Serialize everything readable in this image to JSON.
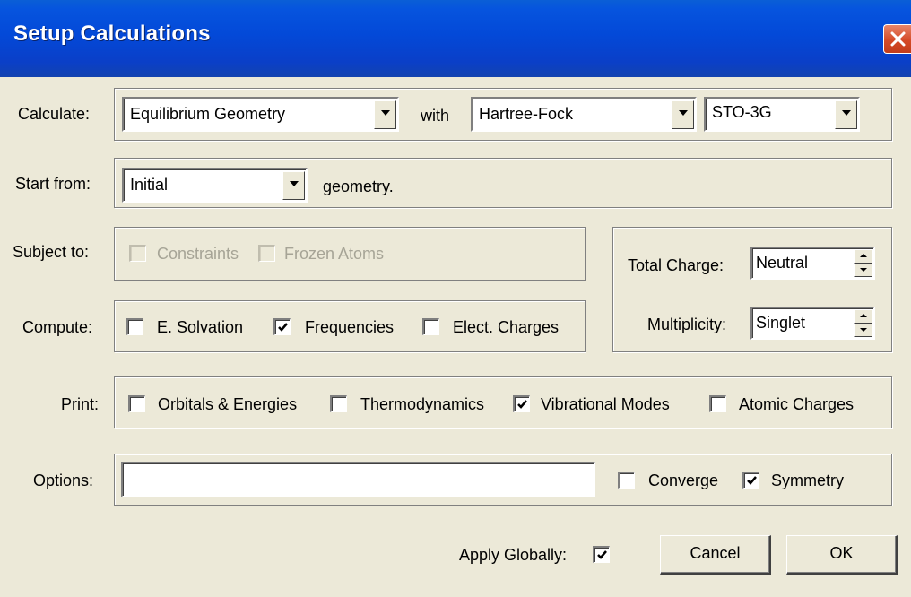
{
  "window": {
    "title": "Setup Calculations"
  },
  "calculate": {
    "label": "Calculate:",
    "task": "Equilibrium Geometry",
    "with_label": "with",
    "method": "Hartree-Fock",
    "basis": "STO-3G"
  },
  "start_from": {
    "label": "Start from:",
    "value": "Initial",
    "suffix": "geometry."
  },
  "subject_to": {
    "label": "Subject to:",
    "constraints": {
      "label": "Constraints",
      "checked": false,
      "enabled": false
    },
    "frozen_atoms": {
      "label": "Frozen Atoms",
      "checked": false,
      "enabled": false
    }
  },
  "compute": {
    "label": "Compute:",
    "e_solvation": {
      "label": "E. Solvation",
      "checked": false
    },
    "frequencies": {
      "label": "Frequencies",
      "checked": true
    },
    "elect_charges": {
      "label": "Elect. Charges",
      "checked": false
    }
  },
  "charge": {
    "total_charge_label": "Total Charge:",
    "total_charge_value": "Neutral",
    "multiplicity_label": "Multiplicity:",
    "multiplicity_value": "Singlet"
  },
  "print": {
    "label": "Print:",
    "orbitals": {
      "label": "Orbitals & Energies",
      "checked": false
    },
    "thermodynamics": {
      "label": "Thermodynamics",
      "checked": false
    },
    "vibrational_modes": {
      "label": "Vibrational Modes",
      "checked": true
    },
    "atomic_charges": {
      "label": "Atomic Charges",
      "checked": false
    }
  },
  "options": {
    "label": "Options:",
    "value": "",
    "converge": {
      "label": "Converge",
      "checked": false
    },
    "symmetry": {
      "label": "Symmetry",
      "checked": true
    }
  },
  "footer": {
    "apply_globally_label": "Apply Globally:",
    "apply_globally_checked": true,
    "cancel_label": "Cancel",
    "ok_label": "OK"
  },
  "icons": {
    "close": "close-icon",
    "dropdown": "chevron-down-icon",
    "check": "checkmark-icon",
    "spin": "spin-updown-icon"
  },
  "colors": {
    "titlebar": "#0349d8",
    "close_button": "#d54a27",
    "dialog_bg": "#ece9d8",
    "disabled_text": "#a6a496"
  }
}
